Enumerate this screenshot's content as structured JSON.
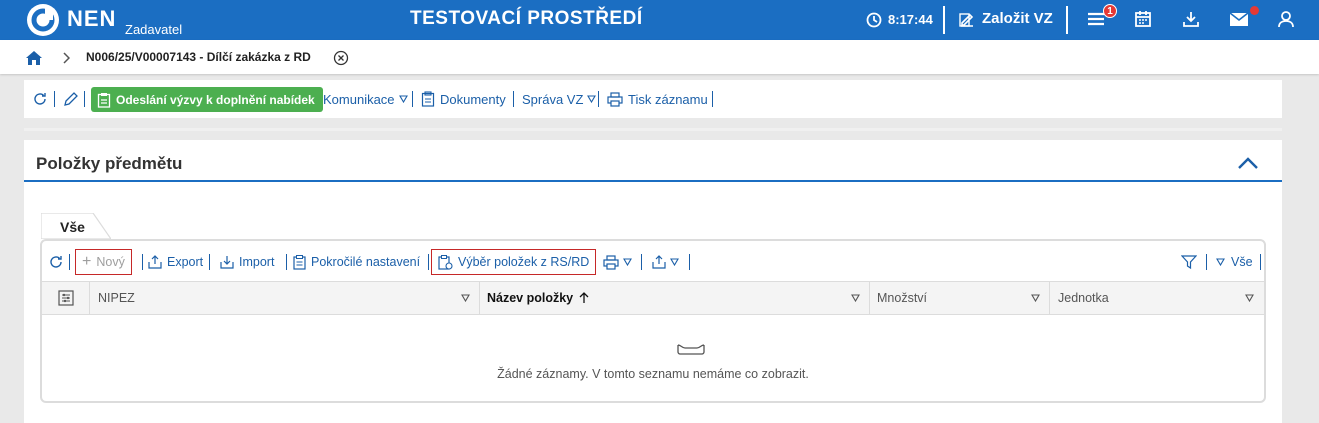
{
  "header": {
    "logo_text": "NEN",
    "logo_sub": "Zadavatel",
    "environment": "TESTOVACÍ PROSTŘEDÍ",
    "time": "8:17:44",
    "create_label": "Založit VZ",
    "notification_count": "1",
    "accent_color": "#1b6ec2"
  },
  "breadcrumb": {
    "title": "N006/25/V00007143 - Dílčí zakázka z RD"
  },
  "actionbar": {
    "send_label": "Odeslání výzvy k doplnění nabídek",
    "communication_label": "Komunikace",
    "documents_label": "Dokumenty",
    "management_label": "Správa VZ",
    "print_label": "Tisk záznamu"
  },
  "panel": {
    "title": "Položky předmětu",
    "tab_label": "Vše",
    "toolbar": {
      "new_label": "Nový",
      "export_label": "Export",
      "import_label": "Import",
      "advanced_label": "Pokročilé nastavení",
      "select_label": "Výběr položek z RS/RD",
      "filter_label": "Vše"
    },
    "columns": [
      "NIPEZ",
      "Název položky",
      "Množství",
      "Jednotka"
    ],
    "empty_text": "Žádné záznamy. V tomto seznamu nemáme co zobrazit."
  }
}
